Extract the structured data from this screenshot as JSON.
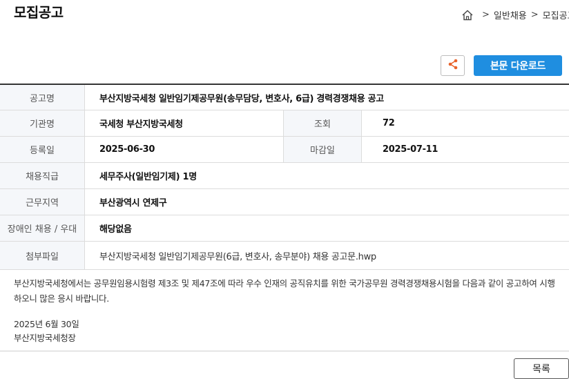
{
  "page_title": "모집공고",
  "breadcrumb": {
    "home_icon": "home-icon",
    "items": [
      "일반채용",
      "모집공고"
    ],
    "separator": ">"
  },
  "actions": {
    "share_icon": "share-icon",
    "download_label": "본문 다운로드",
    "accent_color": "#1f8ee0",
    "share_color": "#e8632b"
  },
  "table": {
    "title_label": "공고명",
    "title_value": "부산지방국세청 일반임기제공무원(송무담당, 변호사, 6급) 경력경쟁채용 공고",
    "org_label": "기관명",
    "org_value": "국세청 부산지방국세청",
    "views_label": "조회",
    "views_value": "72",
    "reg_label": "등록일",
    "reg_value": "2025-06-30",
    "deadline_label": "마감일",
    "deadline_value": "2025-07-11",
    "rank_label": "채용직급",
    "rank_value": "세무주사(일반임기제) 1명",
    "region_label": "근무지역",
    "region_value": "부산광역시 연제구",
    "disabled_label": "장애인 채용 / 우대",
    "disabled_value": "해당없음",
    "attach_label": "첨부파일",
    "attach_value": "부산지방국세청 일반임기제공무원(6급, 변호사, 송무분야) 채용 공고문.hwp"
  },
  "body": {
    "paragraph": "부산지방국세청에서는 공무원임용시험령 제3조 및 제47조에 따라 우수 인재의 공직유치를 위한 국가공무원 경력경쟁채용시험을 다음과 같이 공고하여 시행하오니 많은 응시 바랍니다.",
    "date": "2025년 6월 30일",
    "signer": "부산지방국세청장"
  },
  "list_button_label": "목록"
}
